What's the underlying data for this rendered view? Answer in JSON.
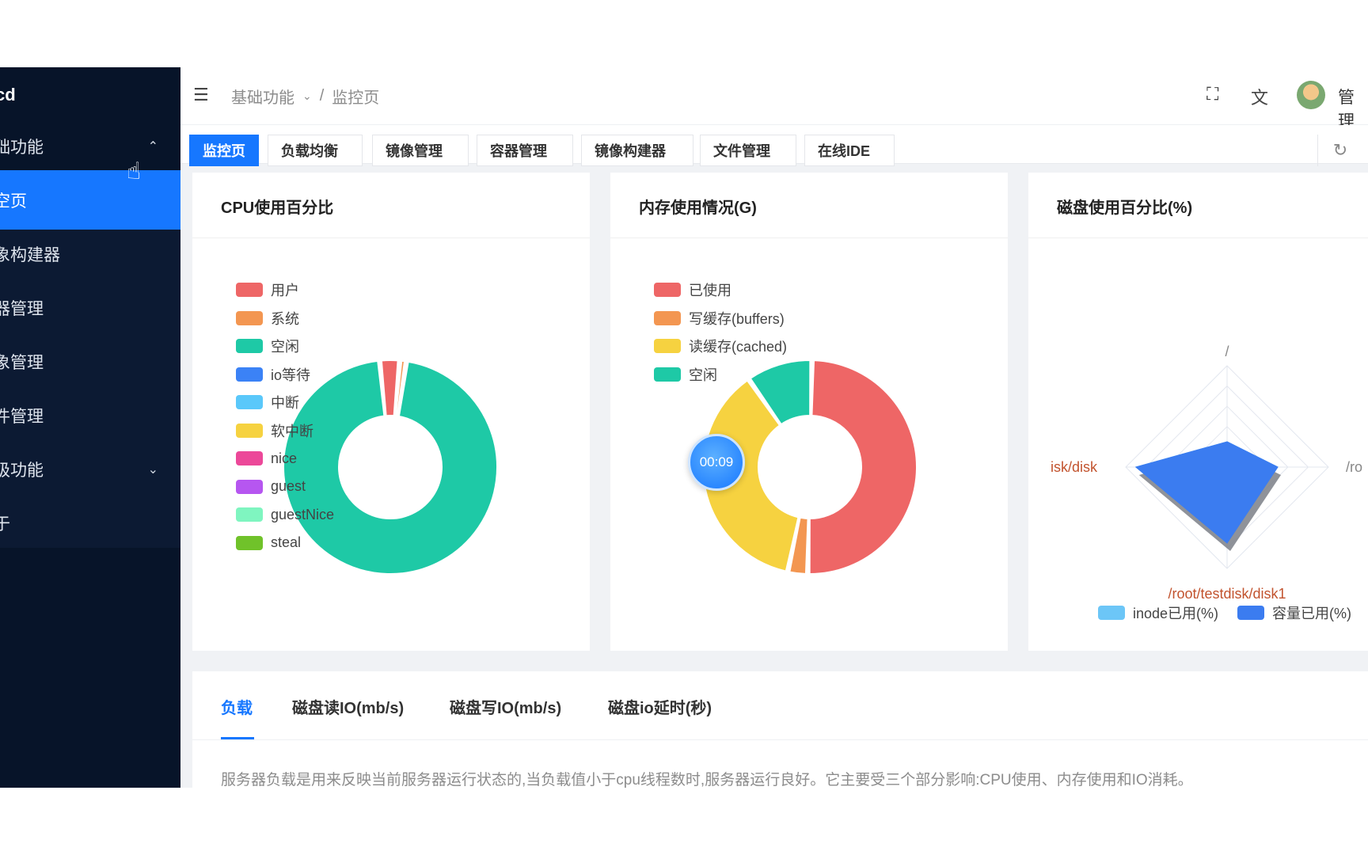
{
  "sidebar": {
    "logo": "cd",
    "items": [
      {
        "label": "础功能",
        "arrow": "⌃"
      },
      {
        "label": "空页"
      },
      {
        "label": "象构建器"
      },
      {
        "label": "器管理"
      },
      {
        "label": "象管理"
      },
      {
        "label": "件管理"
      },
      {
        "label": "级功能",
        "arrow": "⌄"
      },
      {
        "label": "于"
      }
    ]
  },
  "header": {
    "breadcrumb": [
      "基础功能",
      "/",
      "监控页"
    ],
    "username": "管理"
  },
  "tabs": [
    "监控页",
    "负载均衡",
    "镜像管理",
    "容器管理",
    "镜像构建器",
    "文件管理",
    "在线IDE"
  ],
  "cpu_card": {
    "title": "CPU使用百分比",
    "legend": [
      {
        "name": "用户",
        "color": "#ee6666"
      },
      {
        "name": "系统",
        "color": "#f39651"
      },
      {
        "name": "空闲",
        "color": "#1ec9a6"
      },
      {
        "name": "io等待",
        "color": "#3b82f6"
      },
      {
        "name": "中断",
        "color": "#5ac8fa"
      },
      {
        "name": "软中断",
        "color": "#f6d240"
      },
      {
        "name": "nice",
        "color": "#ec4899"
      },
      {
        "name": "guest",
        "color": "#b656f0"
      },
      {
        "name": "guestNice",
        "color": "#7ff5c0"
      },
      {
        "name": "steal",
        "color": "#70c22a"
      }
    ]
  },
  "mem_card": {
    "title": "内存使用情况(G)",
    "legend": [
      {
        "name": "已使用",
        "color": "#ee6666"
      },
      {
        "name": "写缓存(buffers)",
        "color": "#f39651"
      },
      {
        "name": "读缓存(cached)",
        "color": "#f6d240"
      },
      {
        "name": "空闲",
        "color": "#1ec9a6"
      }
    ],
    "timer": "00:09"
  },
  "disk_card": {
    "title": "磁盘使用百分比(%)",
    "axis_labels": [
      "/",
      "/ro",
      "/root/testdisk/disk1",
      "isk/disk"
    ],
    "legend": [
      {
        "name": "inode已用(%)",
        "color": "#6cc6f7"
      },
      {
        "name": "容量已用(%)",
        "color": "#3b7cf0"
      }
    ]
  },
  "chart_data": [
    {
      "type": "pie",
      "title": "CPU使用百分比",
      "categories": [
        "用户",
        "系统",
        "空闲",
        "io等待",
        "中断",
        "软中断",
        "nice",
        "guest",
        "guestNice",
        "steal"
      ],
      "values": [
        3,
        1,
        96,
        0,
        0,
        0,
        0,
        0,
        0,
        0
      ]
    },
    {
      "type": "pie",
      "title": "内存使用情况(G)",
      "categories": [
        "已使用",
        "写缓存(buffers)",
        "读缓存(cached)",
        "空闲"
      ],
      "values": [
        50,
        3,
        37,
        10
      ]
    },
    {
      "type": "radar",
      "title": "磁盘使用百分比(%)",
      "axes": [
        "/",
        "/ro",
        "/root/testdisk/disk1",
        "isk/disk"
      ],
      "series": [
        {
          "name": "inode已用(%)",
          "values": [
            25,
            50,
            75,
            90
          ]
        },
        {
          "name": "容量已用(%)",
          "values": [
            25,
            50,
            75,
            90
          ]
        }
      ]
    }
  ],
  "bottom_tabs": [
    "负载",
    "磁盘读IO(mb/s)",
    "磁盘写IO(mb/s)",
    "磁盘io延时(秒)"
  ],
  "description": "服务器负载是用来反映当前服务器运行状态的,当负载值小于cpu线程数时,服务器运行良好。它主要受三个部分影响:CPU使用、内存使用和IO消耗。"
}
